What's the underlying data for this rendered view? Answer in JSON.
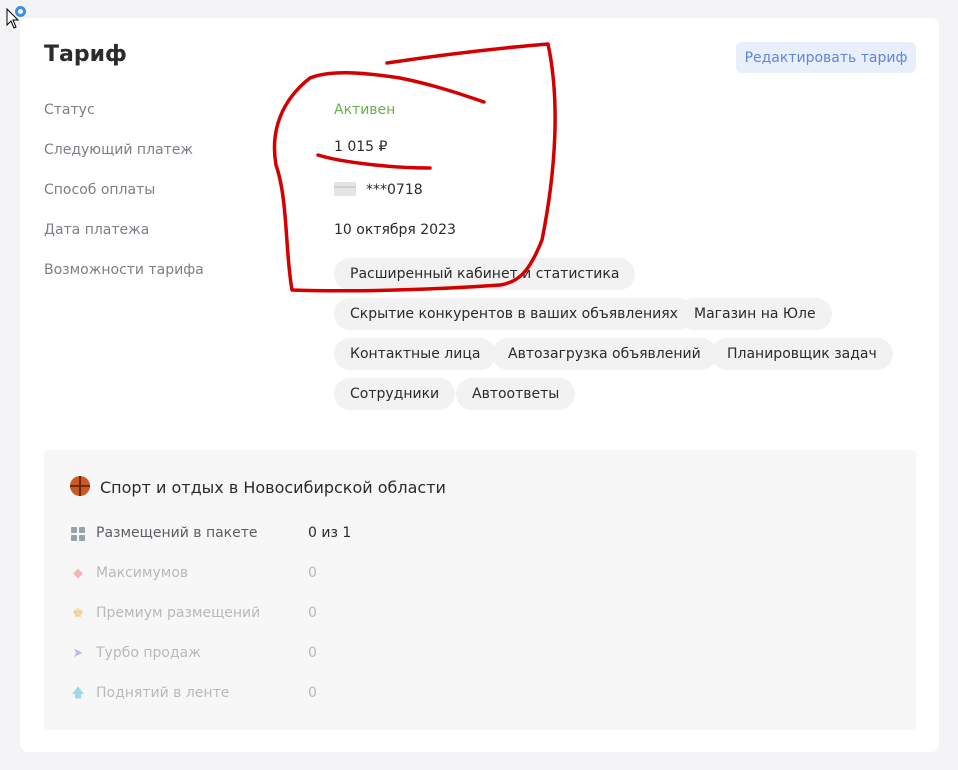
{
  "tariff": {
    "title": "Тариф",
    "edit_button": "Редактировать тариф",
    "rows": [
      {
        "label": "Статус",
        "value": "Активен"
      },
      {
        "label": "Следующий платеж",
        "value": "1 015 ₽"
      },
      {
        "label": "Способ оплаты",
        "value": "***0718"
      },
      {
        "label": "Дата платежа",
        "value": "10 октября 2023"
      },
      {
        "label": "Возможности тарифа"
      }
    ],
    "features": [
      "Расширенный кабинет и статистика",
      "Скрытие конкурентов в ваших объявлениях",
      "Магазин на Юле",
      "Контактные лица",
      "Автозагрузка объявлений",
      "Планировщик задач",
      "Сотрудники",
      "Автоответы"
    ]
  },
  "package": {
    "title": "Спорт и отдых в Новосибирской области",
    "rows": [
      {
        "label": "Размещений в пакете",
        "value": "0 из 1",
        "icon": "grid-icon"
      },
      {
        "label": "Максимумов",
        "value": "0",
        "icon": "diamond-icon"
      },
      {
        "label": "Премиум размещений",
        "value": "0",
        "icon": "crown-icon"
      },
      {
        "label": "Турбо продаж",
        "value": "0",
        "icon": "rocket-icon"
      },
      {
        "label": "Поднятий в ленте",
        "value": "0",
        "icon": "arrow-up-icon"
      }
    ]
  },
  "colors": {
    "active_status": "#6aae4f",
    "edit_button_bg": "#e9eefb",
    "edit_button_text": "#5f86d9",
    "annotation": "#d40000"
  }
}
